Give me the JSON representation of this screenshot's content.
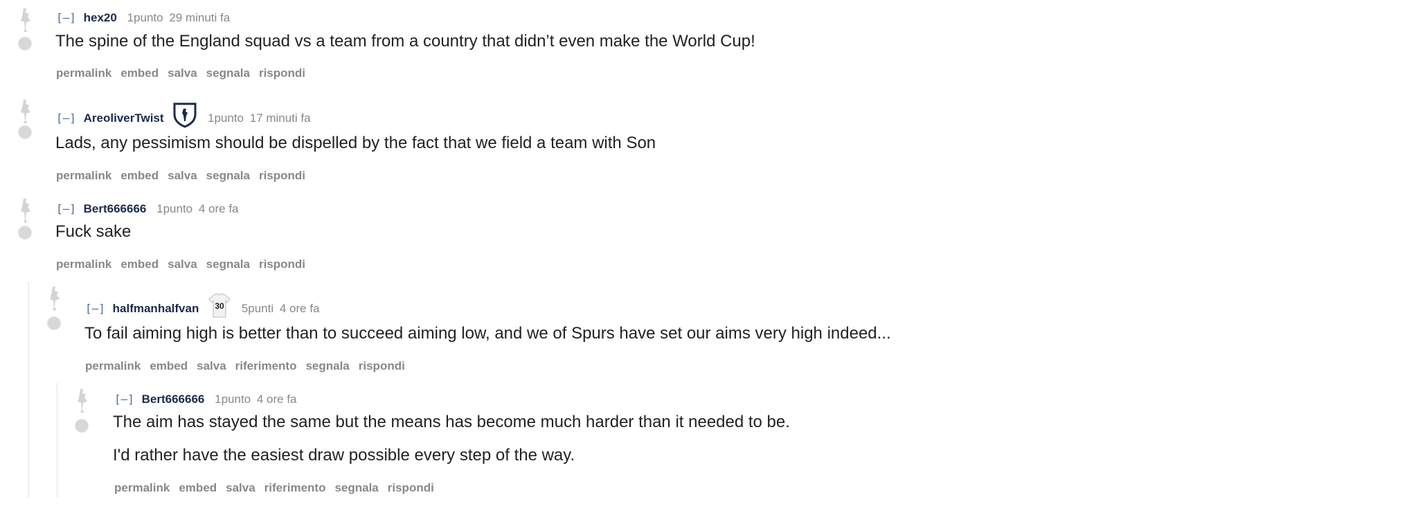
{
  "comments": [
    {
      "collapse": "[–]",
      "author": "hex20",
      "score": "1punto",
      "time": "29 minuti fa",
      "body": [
        "The spine of the England squad vs a team from a country that didn’t even make the World Cup!"
      ],
      "buttons": [
        "permalink",
        "embed",
        "salva",
        "segnala",
        "rispondi"
      ]
    },
    {
      "collapse": "[–]",
      "author": "AreoliverTwist",
      "flair_icon": "spurs-crest-icon",
      "score": "1punto",
      "time": "17 minuti fa",
      "body": [
        "Lads, any pessimism should be dispelled by the fact that we field a team with Son"
      ],
      "buttons": [
        "permalink",
        "embed",
        "salva",
        "segnala",
        "rispondi"
      ]
    },
    {
      "collapse": "[–]",
      "author": "Bert666666",
      "score": "1punto",
      "time": "4 ore fa",
      "body": [
        "Fuck sake"
      ],
      "buttons": [
        "permalink",
        "embed",
        "salva",
        "segnala",
        "rispondi"
      ]
    },
    {
      "collapse": "[–]",
      "author": "halfmanhalfvan",
      "flair_icon": "shirt-icon",
      "flair_text": "30",
      "score": "5punti",
      "time": "4 ore fa",
      "body": [
        "To fail aiming high is better than to succeed aiming low, and we of Spurs have set our aims very high indeed..."
      ],
      "buttons": [
        "permalink",
        "embed",
        "salva",
        "riferimento",
        "segnala",
        "rispondi"
      ]
    },
    {
      "collapse": "[–]",
      "author": "Bert666666",
      "score": "1punto",
      "time": "4 ore fa",
      "body": [
        "The aim has stayed the same but the means has become much harder than it needed to be.",
        "I'd rather have the easiest draw possible every step of the way."
      ],
      "buttons": [
        "permalink",
        "embed",
        "salva",
        "riferimento",
        "segnala",
        "rispondi"
      ]
    }
  ]
}
